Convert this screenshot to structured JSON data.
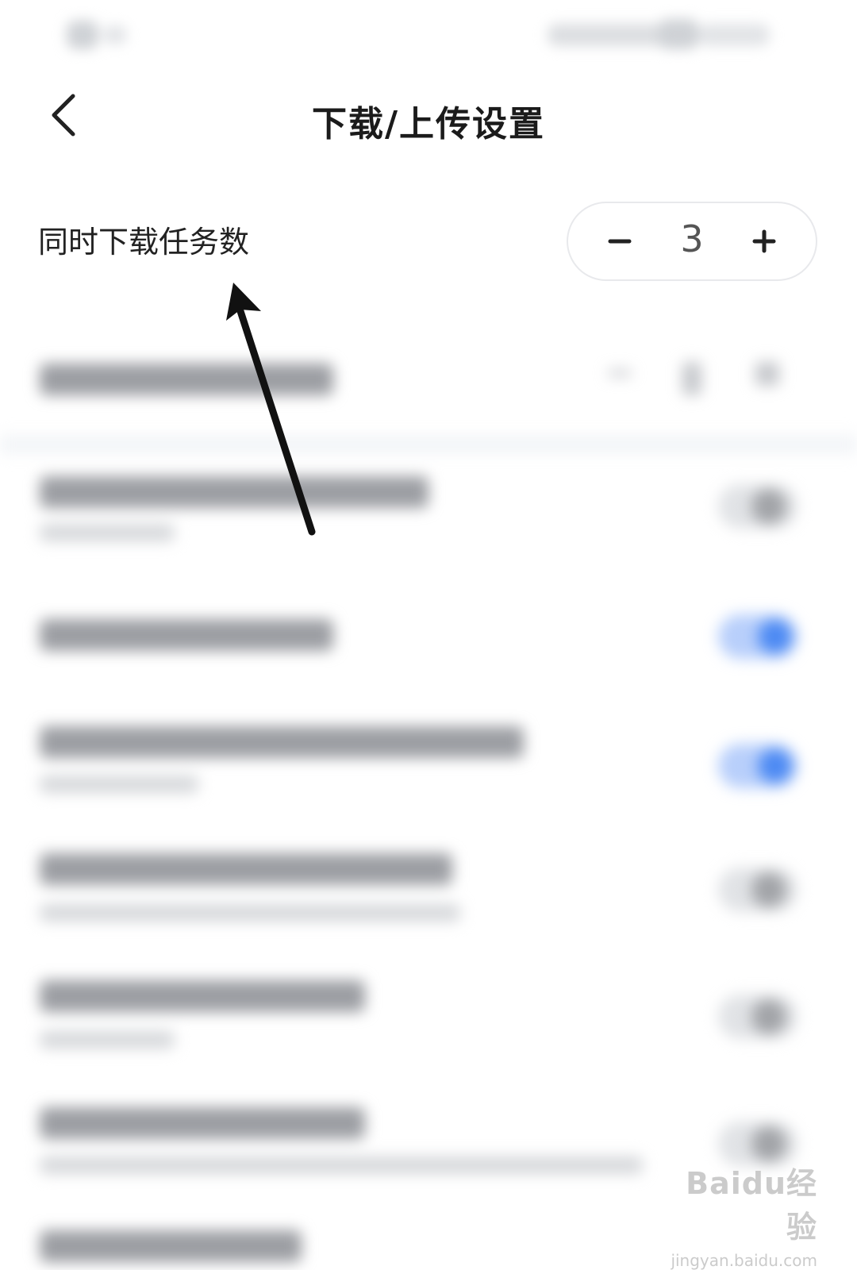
{
  "header": {
    "title": "下载/上传设置",
    "back_icon": "chevron-left-icon"
  },
  "download_tasks": {
    "label": "同时下载任务数",
    "value": "3",
    "minus_icon": "minus-icon",
    "plus_icon": "plus-icon"
  },
  "blurred_toggles": [
    false,
    true,
    true,
    false,
    false,
    false
  ],
  "colors": {
    "accent": "#4d8af3",
    "text": "#1b1b1b",
    "arrow": "#111111"
  },
  "watermark": {
    "logo": "Baidu经验",
    "url": "jingyan.baidu.com"
  }
}
